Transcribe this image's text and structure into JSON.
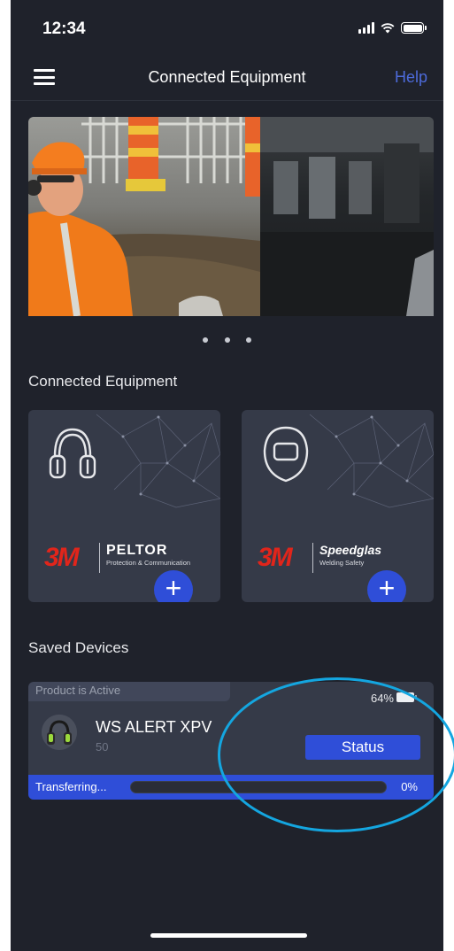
{
  "status_bar": {
    "time": "12:34"
  },
  "nav": {
    "title": "Connected Equipment",
    "help": "Help"
  },
  "carousel": {
    "slide_count": 3,
    "active_index": 0
  },
  "sections": {
    "connected": "Connected Equipment",
    "saved": "Saved Devices"
  },
  "equipment": [
    {
      "brand": "PELTOR",
      "subtitle": "Protection & Communication",
      "logo": "3M",
      "icon": "earmuff-headset-icon",
      "add_label": "+"
    },
    {
      "brand": "Speedglas",
      "subtitle": "Welding Safety",
      "logo": "3M",
      "icon": "welding-helmet-icon",
      "add_label": "+"
    }
  ],
  "device": {
    "active_label": "Product is Active",
    "battery_pct": "64%",
    "battery_level": 0.64,
    "name": "WS ALERT XPV",
    "serial": "50",
    "status_button": "Status",
    "transfer_label": "Transferring...",
    "transfer_pct": "0%",
    "transfer_progress": 0
  },
  "colors": {
    "background": "#1f222b",
    "card": "#353a48",
    "accent": "#2f4ed8",
    "brand_red": "#e1251b",
    "highlight": "#14a6e0"
  }
}
